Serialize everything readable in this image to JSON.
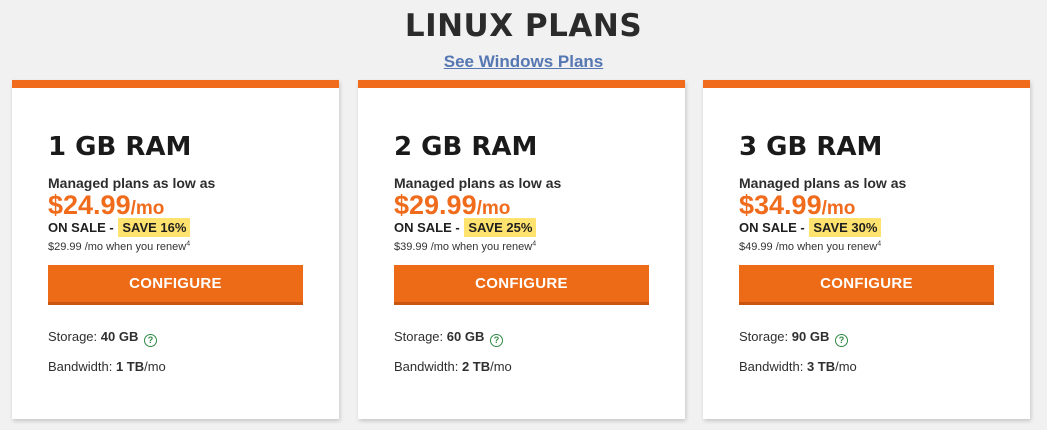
{
  "header": {
    "title": "LINUX PLANS",
    "windows_link": "See Windows Plans"
  },
  "colors": {
    "accent": "#f06b1b",
    "save_badge": "#ffe36e",
    "link": "#5577b2",
    "help_icon": "#2f8a45"
  },
  "labels": {
    "managed": "Managed plans as low as",
    "unit": "/mo",
    "on_sale": "ON SALE - ",
    "renew_suffix": " /mo when you renew",
    "renew_footnote": "4",
    "configure": "CONFIGURE",
    "storage": "Storage: ",
    "bandwidth": "Bandwidth: ",
    "help_glyph": "?"
  },
  "plans": [
    {
      "ram": "1 GB RAM",
      "price": "$24.99",
      "save": "SAVE 16%",
      "renew_price": "$29.99",
      "storage": "40 GB",
      "bandwidth": "1 TB",
      "bandwidth_unit": "/mo"
    },
    {
      "ram": "2 GB RAM",
      "price": "$29.99",
      "save": "SAVE 25%",
      "renew_price": "$39.99",
      "storage": "60 GB",
      "bandwidth": "2 TB",
      "bandwidth_unit": "/mo"
    },
    {
      "ram": "3 GB RAM",
      "price": "$34.99",
      "save": "SAVE 30%",
      "renew_price": "$49.99",
      "storage": "90 GB",
      "bandwidth": "3 TB",
      "bandwidth_unit": "/mo"
    }
  ]
}
